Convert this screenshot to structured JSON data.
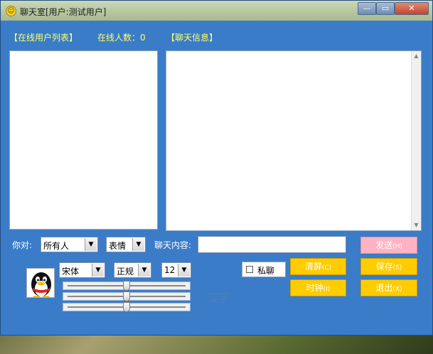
{
  "window": {
    "title": "聊天室[用户:测试用户]"
  },
  "header": {
    "user_list_label": "【在线用户列表】",
    "online_count_label": "在线人数：",
    "online_count": "0",
    "chat_info_label": "【聊天信息】"
  },
  "controls": {
    "to_label": "你对:",
    "recipient": "所有人",
    "emotion": "表情",
    "content_label": "聊天内容:",
    "chat_input_value": "",
    "font_family": "宋体",
    "font_style": "正规",
    "font_size": "12",
    "private_label": "私聊",
    "preview_text": "汉字"
  },
  "buttons": {
    "send": "发送",
    "send_key": "(H)",
    "clear": "清屏",
    "clear_key": "(C)",
    "save": "保存",
    "save_key": "(S)",
    "clock": "时钟",
    "clock_key": "(I)",
    "exit": "退出",
    "exit_key": "(X)"
  },
  "sliders": [
    {
      "name": "red",
      "value": 0.5
    },
    {
      "name": "green",
      "value": 0.5
    },
    {
      "name": "blue",
      "value": 0.5
    }
  ],
  "icons": {
    "app": "smiley-icon",
    "avatar": "penguin-avatar-icon",
    "dropdown": "chevron-down-icon"
  },
  "colors": {
    "window_bg": "#3a7cc8",
    "header_label": "#ffff66",
    "action_button": "#ffcc00",
    "send_button": "#ffb3c2"
  }
}
